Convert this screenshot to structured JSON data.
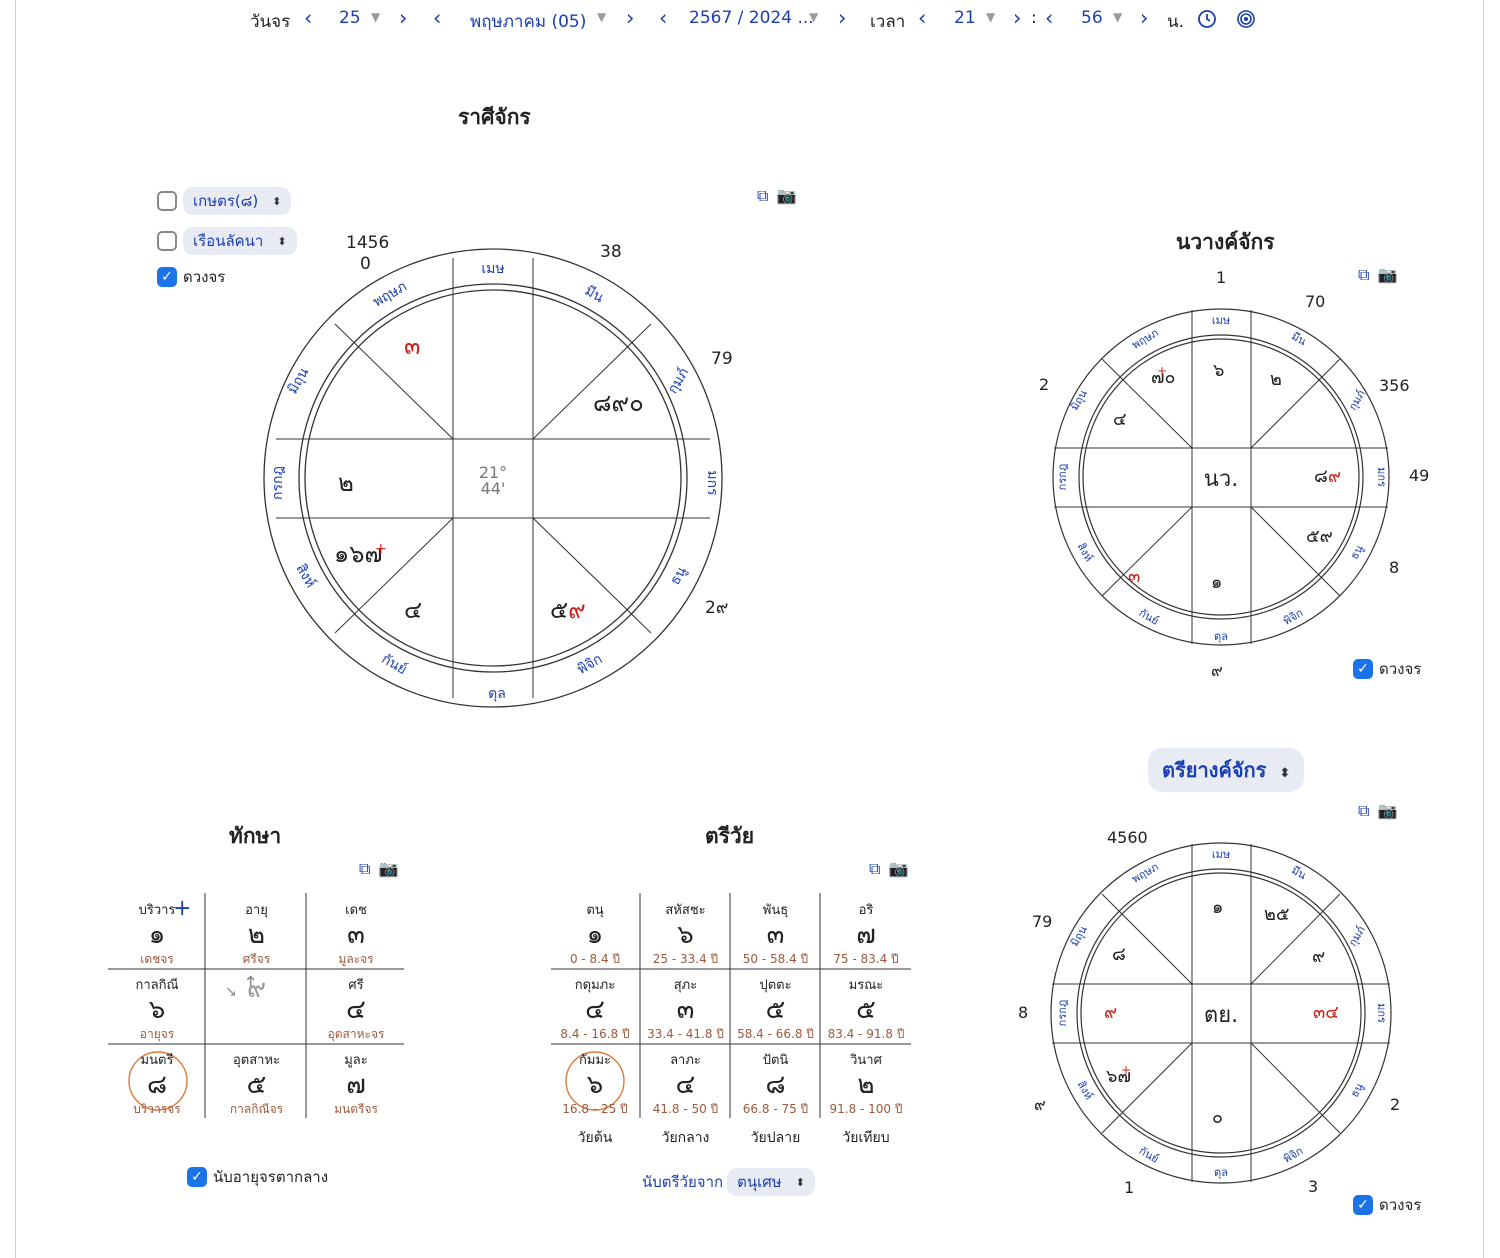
{
  "nav": {
    "label_day": "วันจร",
    "day": "25",
    "month": "พฤษภาคม (05)",
    "year": "2567 / 2024 ...",
    "label_time": "เวลา",
    "hour": "21",
    "colon": ":",
    "minute": "56",
    "unit": "น."
  },
  "rasi": {
    "title": "ราศีจักร",
    "degree": "21°",
    "minute": "44'",
    "options": [
      "เกษตร(๘)",
      "เรือนลัคนา"
    ],
    "checkbox_label": "ดวงจร",
    "signs": [
      "เมษ",
      "มีน",
      "กุมภ์",
      "มกร",
      "ธนู",
      "พิจิก",
      "ตุล",
      "กันย์",
      "สิงห์",
      "กรกฎ",
      "มิถุน",
      "พฤษภ"
    ],
    "outer": {
      "nnw": "1456",
      "nnw2": "0",
      "nne": "38",
      "ene": "79",
      "ese": "2๙"
    },
    "houses": {
      "nw": "๓",
      "ne": "๘๙๐",
      "w": "๒",
      "sw_a": "๑๖",
      "sw_b": "๗",
      "sw_plus": "+",
      "ssw": "๔",
      "se_a": "๕",
      "se_b": "๙"
    }
  },
  "navang": {
    "title": "นวางค์จักร",
    "center": "นว.",
    "checkbox_label": "ดวงจร",
    "signs": [
      "เมษ",
      "มีน",
      "กุมภ์",
      "มกร",
      "ธนู",
      "พิจิก",
      "ตุล",
      "กันย์",
      "สิงห์",
      "กรกฎ",
      "มิถุน",
      "พฤษภ"
    ],
    "outer": {
      "n": "1",
      "nne": "70",
      "ene": "356",
      "e": "49",
      "ese": "8",
      "s": "๙",
      "w": "2"
    },
    "houses": {
      "nnw_a": "๗",
      "nnw_plus": "+",
      "nnw_b": "๐",
      "wnw": "๔",
      "n": "๖",
      "nne": "๒",
      "e_a": "๘",
      "e_b": "๙",
      "ese": "๕๙",
      "wsw": "๓",
      "s": "๑"
    }
  },
  "treeyang": {
    "title": "ตรียางค์จักร",
    "center": "ตย.",
    "checkbox_label": "ดวงจร",
    "signs": [
      "เมษ",
      "มีน",
      "กุมภ์",
      "มกร",
      "ธนู",
      "พิจิก",
      "ตุล",
      "กันย์",
      "สิงห์",
      "กรกฎ",
      "มิถุน",
      "พฤษภ"
    ],
    "outer": {
      "nnw": "4560",
      "wnw": "79",
      "w": "8",
      "wsw": "๙",
      "ssw": "1",
      "sse": "3",
      "ese": "2"
    },
    "houses": {
      "n": "๑",
      "nne": "๒๕",
      "ene": "๙",
      "wnw": "๘",
      "w": "๙",
      "e": "๓๔",
      "wsw_a": "๖",
      "wsw_b": "๗",
      "wsw_plus": "+",
      "s": "๐"
    }
  },
  "taksa": {
    "title": "ทักษา",
    "cells": [
      {
        "label": "บริวาร",
        "num": "๑",
        "sub": "เดชจร"
      },
      {
        "label": "อายุ",
        "num": "๒",
        "sub": "ศรีจร"
      },
      {
        "label": "เดช",
        "num": "๓",
        "sub": "มูละจร"
      },
      {
        "label": "กาลกิณี",
        "num": "๖",
        "sub": "อายุจร"
      },
      {
        "label": "",
        "num": "๙",
        "sub": ""
      },
      {
        "label": "ศรี",
        "num": "๔",
        "sub": "อุตสาหะจร"
      },
      {
        "label": "มนตรี",
        "num": "๘",
        "sub": "บริวารจร"
      },
      {
        "label": "อุตสาหะ",
        "num": "๕",
        "sub": "กาลกิณีจร"
      },
      {
        "label": "มูละ",
        "num": "๗",
        "sub": "มนตรีจร"
      }
    ],
    "plus": "+",
    "checkbox_label": "นับอายุจรตากลาง"
  },
  "treewai": {
    "title": "ตรีวัย",
    "cells": [
      {
        "label": "ตนุ",
        "num": "๑",
        "sub": "0 - 8.4 ปี"
      },
      {
        "label": "สหัสชะ",
        "num": "๖",
        "sub": "25 - 33.4 ปี"
      },
      {
        "label": "พันธุ",
        "num": "๓",
        "sub": "50 - 58.4 ปี"
      },
      {
        "label": "อริ",
        "num": "๗",
        "sub": "75 - 83.4 ปี"
      },
      {
        "label": "กดุมภะ",
        "num": "๔",
        "sub": "8.4 - 16.8 ปี"
      },
      {
        "label": "สุภะ",
        "num": "๓",
        "sub": "33.4 - 41.8 ปี"
      },
      {
        "label": "ปุตตะ",
        "num": "๕",
        "sub": "58.4 - 66.8 ปี"
      },
      {
        "label": "มรณะ",
        "num": "๕",
        "sub": "83.4 - 91.8 ปี"
      },
      {
        "label": "กัมมะ",
        "num": "๖",
        "sub": "16.8 - 25 ปี"
      },
      {
        "label": "ลาภะ",
        "num": "๔",
        "sub": "41.8 - 50 ปี"
      },
      {
        "label": "ปัตนิ",
        "num": "๘",
        "sub": "66.8 - 75 ปี"
      },
      {
        "label": "วินาศ",
        "num": "๒",
        "sub": "91.8 - 100 ปี"
      }
    ],
    "ages": [
      "วัยต้น",
      "วัยกลาง",
      "วัยปลาย",
      "วัยเทียบ"
    ],
    "count_label": "นับตรีวัยจาก",
    "count_value": "ตนุเศษ"
  },
  "colors": {
    "accent": "#1a3fb0",
    "red": "#d0201a",
    "brown": "#9c5a3c",
    "circle": "#e07a3a",
    "check": "#1a73e8"
  }
}
